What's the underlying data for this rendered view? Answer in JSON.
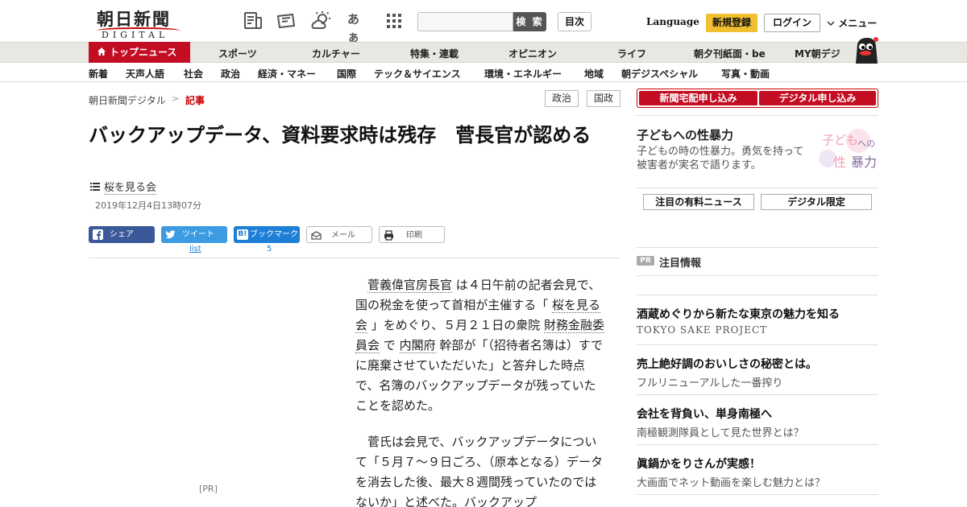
{
  "header": {
    "logo_kanji": "朝日新聞",
    "logo_sub": "DIGITAL",
    "search_button": "検 索",
    "toc_button": "目次",
    "language": "Language",
    "register": "新規登録",
    "login": "ログイン",
    "menu": "メニュー",
    "font_size_glyph": "あぁ"
  },
  "categories": [
    "トップニュース",
    "スポーツ",
    "カルチャー",
    "特集・連載",
    "オピニオン",
    "ライフ",
    "朝夕刊紙面・be",
    "MY朝デジ"
  ],
  "subnav": [
    "新着",
    "天声人語",
    "社会",
    "政治",
    "経済・マネー",
    "国際",
    "テック＆サイエンス",
    "環境・エネルギー",
    "地域",
    "朝デジスペシャル",
    "写真・動画"
  ],
  "breadcrumb": {
    "home": "朝日新聞デジタル",
    "sep": ">",
    "current": "記事"
  },
  "tags": [
    "政治",
    "国政"
  ],
  "article": {
    "headline": "バックアップデータ、資料要求時は残存　菅長官が認める",
    "series": "桜を見る会",
    "date": "2019年12月4日13時07分",
    "share": {
      "facebook": "シェア",
      "twitter": "ツイート",
      "hatena": "ブックマーク",
      "mail": "メール",
      "print": "印刷",
      "twitter_count": "list",
      "hatena_count": "5"
    },
    "pr_label": "[PR]",
    "p1": {
      "a": "菅義偉官房長官",
      "b": "は４日午前の記者会見で、国の税金を使って首相が主催する「",
      "c": "桜を見る会",
      "d": "」をめぐり、５月２１日の衆院",
      "e": "財務金融委員会",
      "f": "で",
      "g": "内閣府",
      "h": "幹部が「（招待者名簿は）すでに廃棄させていただいた」と答弁した時点で、名簿のバックアップデータが残っていたことを認めた。"
    },
    "p2": "菅氏は会見で、バックアップデータについて「５月７～９日ごろ、（原本となる）データを消去した後、最大８週間残っていたのではないか」と述べた。バックアップ"
  },
  "sidebar": {
    "apply_newspaper": "新聞宅配申し込み",
    "apply_digital": "デジタル申し込み",
    "feature_title": "子どもへの性暴力",
    "feature_desc": "子どもの時の性暴力。勇気を持って被害者が実名で語ります。",
    "feature_img": {
      "t1": "子ども",
      "t2": "への",
      "t3": "性",
      "t4": "暴力"
    },
    "tab_paid": "注目の有料ニュース",
    "tab_digital": "デジタル限定",
    "pr_badge": "PR",
    "pr_heading": "注目情報",
    "pr_items": [
      {
        "title": "酒蔵めぐりから新たな東京の魅力を知る",
        "sub": "TOKYO SAKE PROJECT"
      },
      {
        "title": "売上絶好調のおいしさの秘密とは。",
        "sub": "フルリニューアルした一番搾り"
      },
      {
        "title": "会社を背負い、単身南極へ",
        "sub": "南極観測隊員として見た世界とは？"
      },
      {
        "title": "眞鍋かをりさんが実感！",
        "sub": "大画面でネット動画を楽しむ魅力とは？"
      }
    ]
  },
  "colors": {
    "brand_red": "#c30d23",
    "register_yellow": "#f0c030",
    "facebook": "#3b5998",
    "twitter": "#3d9be4",
    "hatena": "#1d7fd6"
  }
}
